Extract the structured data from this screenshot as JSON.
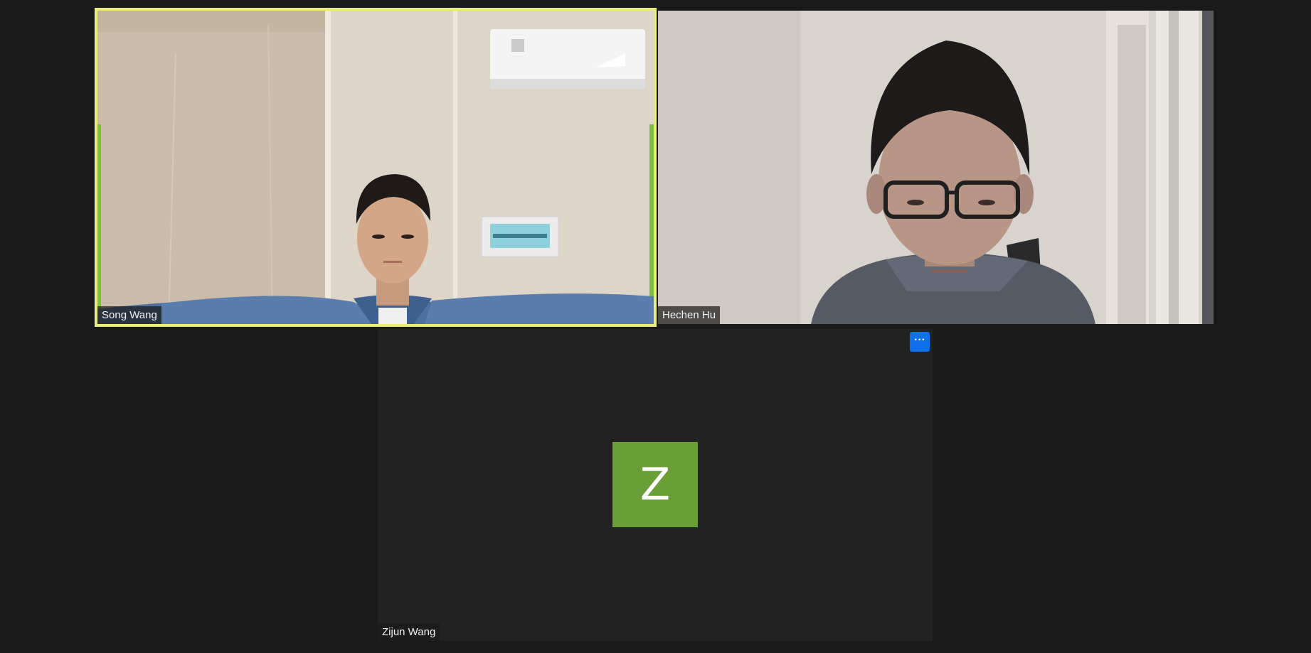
{
  "participants": [
    {
      "id": "song",
      "name": "Song Wang",
      "video_on": true,
      "active_speaker": true,
      "highlight_color": "#e9ec7b"
    },
    {
      "id": "hechen",
      "name": "Hechen Hu",
      "video_on": true,
      "active_speaker": false
    },
    {
      "id": "zijun",
      "name": "Zijun Wang",
      "video_on": false,
      "active_speaker": false,
      "avatar_initial": "Z",
      "avatar_color": "#6a9e37",
      "more_button_label": "···",
      "more_button_icon": "ellipsis-icon"
    }
  ],
  "colors": {
    "background": "#1a1a1a",
    "tile_off_background": "#222222",
    "more_button": "#0e71eb"
  }
}
